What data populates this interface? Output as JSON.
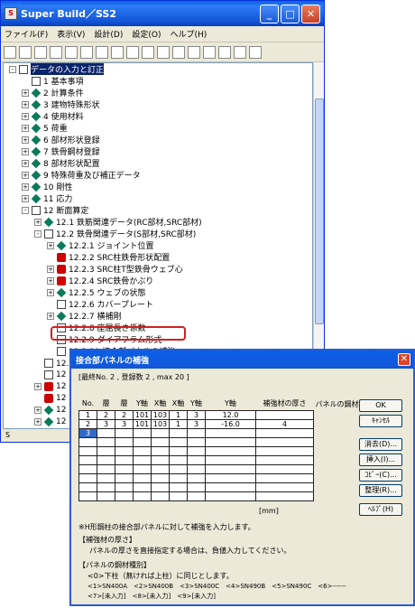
{
  "window": {
    "title": "Super Build／SS2"
  },
  "menu": [
    "ファイル(F)",
    "表示(V)",
    "設計(D)",
    "設定(O)",
    "ヘルプ(H)"
  ],
  "status": "S",
  "tree": [
    {
      "label": "データの入力と訂正",
      "lvl": 0,
      "icon": "book",
      "exp": "-",
      "sel": true
    },
    {
      "label": "1 基本事項",
      "lvl": 1,
      "icon": "page"
    },
    {
      "label": "2 計算条件",
      "lvl": 1,
      "icon": "gem",
      "exp": "+"
    },
    {
      "label": "3 建物特殊形状",
      "lvl": 1,
      "icon": "gem",
      "exp": "+"
    },
    {
      "label": "4 使用材料",
      "lvl": 1,
      "icon": "gem",
      "exp": "+"
    },
    {
      "label": "5 荷重",
      "lvl": 1,
      "icon": "gem",
      "exp": "+"
    },
    {
      "label": "6 部材形状登録",
      "lvl": 1,
      "icon": "gem",
      "exp": "+"
    },
    {
      "label": "7 鉄骨鋼材登録",
      "lvl": 1,
      "icon": "gem",
      "exp": "+"
    },
    {
      "label": "8 部材形状配置",
      "lvl": 1,
      "icon": "gem",
      "exp": "+"
    },
    {
      "label": "9 特殊荷重及び補正データ",
      "lvl": 1,
      "icon": "gem",
      "exp": "+"
    },
    {
      "label": "10 剛性",
      "lvl": 1,
      "icon": "gem",
      "exp": "+"
    },
    {
      "label": "11 応力",
      "lvl": 1,
      "icon": "gem",
      "exp": "+"
    },
    {
      "label": "12 断面算定",
      "lvl": 1,
      "icon": "book",
      "exp": "-"
    },
    {
      "label": "12.1 鉄筋関連データ(RC部材,SRC部材)",
      "lvl": 2,
      "icon": "gem",
      "exp": "+"
    },
    {
      "label": "12.2 鉄骨関連データ(S部材,SRC部材)",
      "lvl": 2,
      "icon": "book",
      "exp": "-"
    },
    {
      "label": "12.2.1 ジョイント位置",
      "lvl": 3,
      "icon": "gem",
      "exp": "+"
    },
    {
      "label": "12.2.2 SRC柱鉄骨形状配置",
      "lvl": 3,
      "icon": "red"
    },
    {
      "label": "12.2.3 SRC柱T型鉄骨ウェブ心",
      "lvl": 3,
      "icon": "red",
      "exp": "+"
    },
    {
      "label": "12.2.4 SRC鉄骨かぶり",
      "lvl": 3,
      "icon": "red",
      "exp": "+"
    },
    {
      "label": "12.2.5 ウェブの状態",
      "lvl": 3,
      "icon": "gem",
      "exp": "+"
    },
    {
      "label": "12.2.6 カバープレート",
      "lvl": 3,
      "icon": "page"
    },
    {
      "label": "12.2.7 横補剛",
      "lvl": 3,
      "icon": "gem",
      "exp": "+"
    },
    {
      "label": "12.2.8 座屈長さ係数",
      "lvl": 3,
      "icon": "page"
    },
    {
      "label": "12.2.9 ダイアフラム形式",
      "lvl": 3,
      "icon": "page"
    },
    {
      "label": "12.2.10 接合部パネルの補強",
      "lvl": 3,
      "icon": "page"
    },
    {
      "label": "12.3 梁継手と配動",
      "lvl": 2,
      "icon": "page"
    },
    {
      "label": "12",
      "lvl": 2,
      "icon": "page"
    },
    {
      "label": "12",
      "lvl": 2,
      "icon": "red",
      "exp": "+"
    },
    {
      "label": "12",
      "lvl": 2,
      "icon": "red"
    },
    {
      "label": "12",
      "lvl": 2,
      "icon": "gem",
      "exp": "+"
    },
    {
      "label": "12",
      "lvl": 2,
      "icon": "gem",
      "exp": "+"
    },
    {
      "label": "13 基",
      "lvl": 1,
      "icon": "gem",
      "exp": "+"
    }
  ],
  "dialog": {
    "title": "接合部パネルの補強",
    "info": "[最終No. 2 , 登録数 2 , max 20 ]",
    "headers": [
      "No.",
      "層",
      "層",
      "Y軸",
      "X軸",
      "X軸",
      "Y軸",
      "Y軸",
      "補強材の厚さ",
      "パネルの鋼材種別"
    ],
    "rows": [
      [
        "1",
        "2",
        "2",
        "101",
        "103",
        "1",
        "3",
        "12.0",
        ""
      ],
      [
        "2",
        "3",
        "3",
        "101",
        "103",
        "1",
        "3",
        "-16.0",
        "4"
      ],
      [
        "3",
        "",
        "",
        "",
        "",
        "",
        "",
        "",
        ""
      ]
    ],
    "unit": "[mm]",
    "buttons": [
      "OK",
      "ｷｬﾝｾﾙ",
      "消去(D)...",
      "挿入(I)...",
      "ｺﾋﾟｰ(C)...",
      "整理(R)...",
      "ﾍﾙﾌﾟ(H)"
    ],
    "notes": [
      "※H形鋼柱の接合部パネルに対して補強を入力します。",
      "【補強材の厚さ】",
      "パネルの厚さを直接指定する場合は、負値入力してください。",
      "【パネルの鋼材種別】",
      "<0>下柱（無ければ上柱）に同じとします。",
      "<1>SN400A　<2>SN400B　<3>SN400C　<4>SN490B　<5>SN490C　<6>------",
      "<7>[未入力]　<8>[未入力]　<9>[未入力]"
    ]
  }
}
